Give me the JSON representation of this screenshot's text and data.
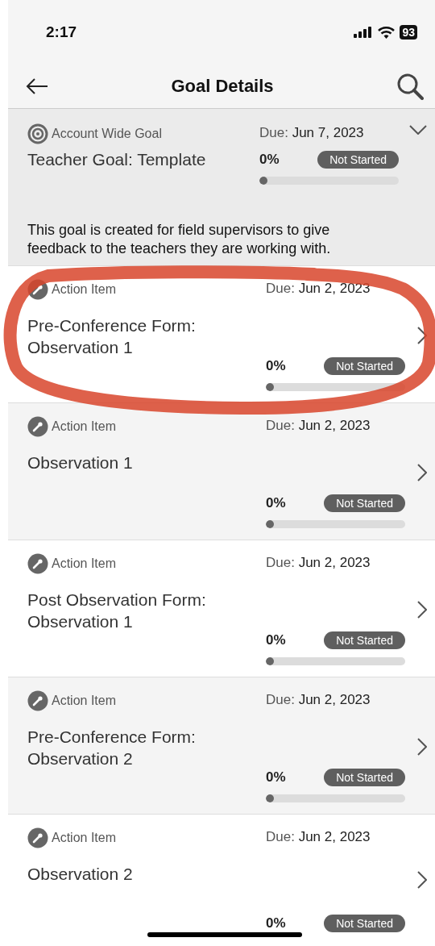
{
  "status_bar": {
    "time": "2:17",
    "battery": "93"
  },
  "header": {
    "title": "Goal Details"
  },
  "goal": {
    "type_label": "Account Wide Goal",
    "title": "Teacher Goal: Template",
    "due_label": "Due:",
    "due_date": "Jun 7, 2023",
    "percent": "0%",
    "status": "Not Started",
    "level": 0,
    "description": "This goal is created for field supervisors to give feedback to the teachers they are working with."
  },
  "items": [
    {
      "type_label": "Action Item",
      "title": "Pre-Conference Form: Observation 1",
      "due_label": "Due:",
      "due_date": "Jun 2, 2023",
      "percent": "0%",
      "status": "Not Started",
      "level": 0
    },
    {
      "type_label": "Action Item",
      "title": "Observation 1",
      "due_label": "Due:",
      "due_date": "Jun 2, 2023",
      "percent": "0%",
      "status": "Not Started",
      "level": 0
    },
    {
      "type_label": "Action Item",
      "title": "Post Observation Form: Observation 1",
      "due_label": "Due:",
      "due_date": "Jun 2, 2023",
      "percent": "0%",
      "status": "Not Started",
      "level": 0
    },
    {
      "type_label": "Action Item",
      "title": "Pre-Conference Form: Observation 2",
      "due_label": "Due:",
      "due_date": "Jun 2, 2023",
      "percent": "0%",
      "status": "Not Started",
      "level": 0
    },
    {
      "type_label": "Action Item",
      "title": "Observation 2",
      "due_label": "Due:",
      "due_date": "Jun 2, 2023",
      "percent": "0%",
      "status": "Not Started"
    }
  ]
}
